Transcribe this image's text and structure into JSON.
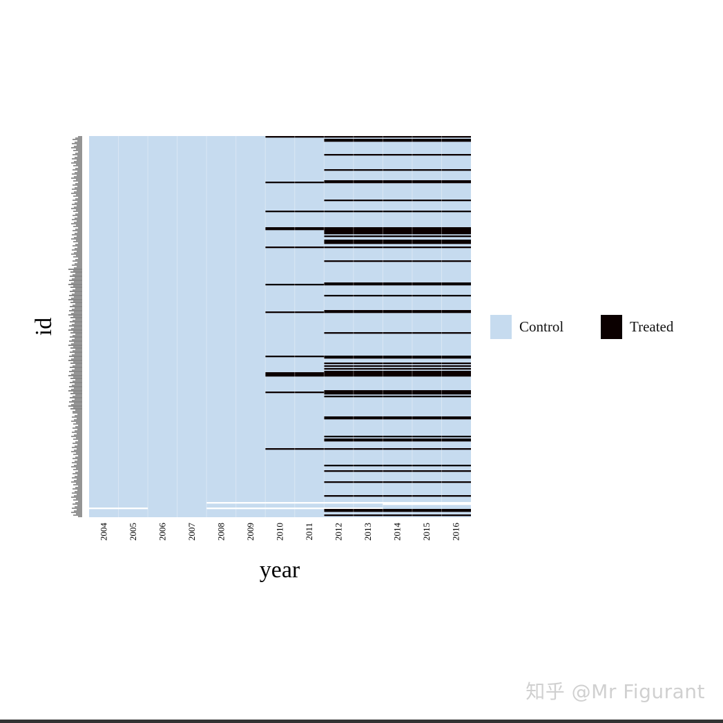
{
  "chart_data": {
    "type": "heatmap",
    "xlabel": "year",
    "ylabel": "id",
    "x_ticks": [
      "2004",
      "2005",
      "2006",
      "2007",
      "2008",
      "2009",
      "2010",
      "2011",
      "2012",
      "2013",
      "2014",
      "2015",
      "2016"
    ],
    "n_units": 276,
    "colors": {
      "control": "#c6dbef",
      "treated": "#0b0000",
      "missing": "#ffffff"
    },
    "legend": {
      "position": "right",
      "items": [
        "Control",
        "Treated"
      ]
    },
    "treated_units": [
      {
        "start": 2010,
        "units": [
          0,
          33,
          54,
          66,
          67,
          80,
          107,
          127,
          159,
          171,
          172,
          173,
          185,
          226
        ]
      },
      {
        "start": 2012,
        "units": [
          2,
          3,
          13,
          24,
          32,
          46,
          68,
          69,
          70,
          72,
          75,
          76,
          77,
          90,
          106,
          115,
          126,
          142,
          160,
          164,
          166,
          168,
          170,
          184,
          186,
          188,
          203,
          204,
          217,
          219,
          220,
          238,
          242,
          250,
          260,
          270,
          271,
          274
        ]
      }
    ],
    "missing_cells": [
      {
        "unit": 265,
        "years": [
          2008,
          2009,
          2010,
          2011,
          2012,
          2013,
          2014,
          2015,
          2016
        ]
      },
      {
        "unit": 266,
        "years": [
          2014,
          2015,
          2016
        ]
      },
      {
        "unit": 269,
        "years": [
          2004,
          2005,
          2008,
          2009,
          2010,
          2011,
          2012,
          2013
        ]
      }
    ]
  },
  "watermark": "知乎 @Mr Figurant"
}
